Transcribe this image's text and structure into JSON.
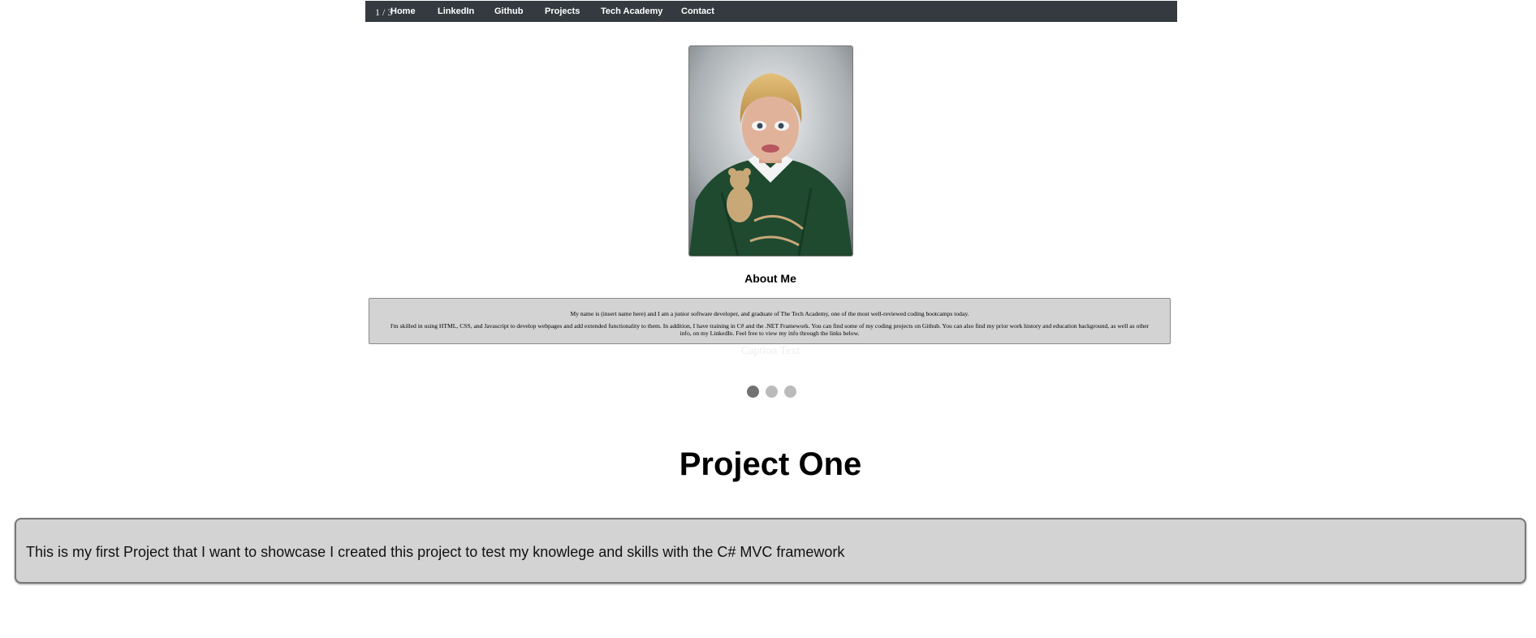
{
  "slideshow": {
    "counter": "1 / 3",
    "caption": "Caption Text",
    "dots": [
      {
        "active": true
      },
      {
        "active": false
      },
      {
        "active": false
      }
    ]
  },
  "nav": {
    "items": [
      {
        "label": "Home"
      },
      {
        "label": "LinkedIn"
      },
      {
        "label": "Github"
      },
      {
        "label": "Projects"
      },
      {
        "label": "Tech Academy"
      },
      {
        "label": "Contact"
      }
    ]
  },
  "about": {
    "heading": "About Me",
    "paragraph1": "My name is (insert name here) and I am a junior software developer, and graduate of The Tech Academy, one of the most well-reviewed coding bootcamps today.",
    "paragraph2": "I'm skilled in using HTML, CSS, and Javascript to develop webpages and add extended functionality to them. In addition, I have training in C# and the .NET Framework. You can find some of my coding projects on Github. You can also find my prior work history and education background, as well as other info, on my LinkedIn. Feel free to view my info through the links below."
  },
  "project": {
    "title": "Project One",
    "description": "This is my first Project that I want to showcase I created this project to test my knowlege and skills with the C# MVC framework"
  }
}
